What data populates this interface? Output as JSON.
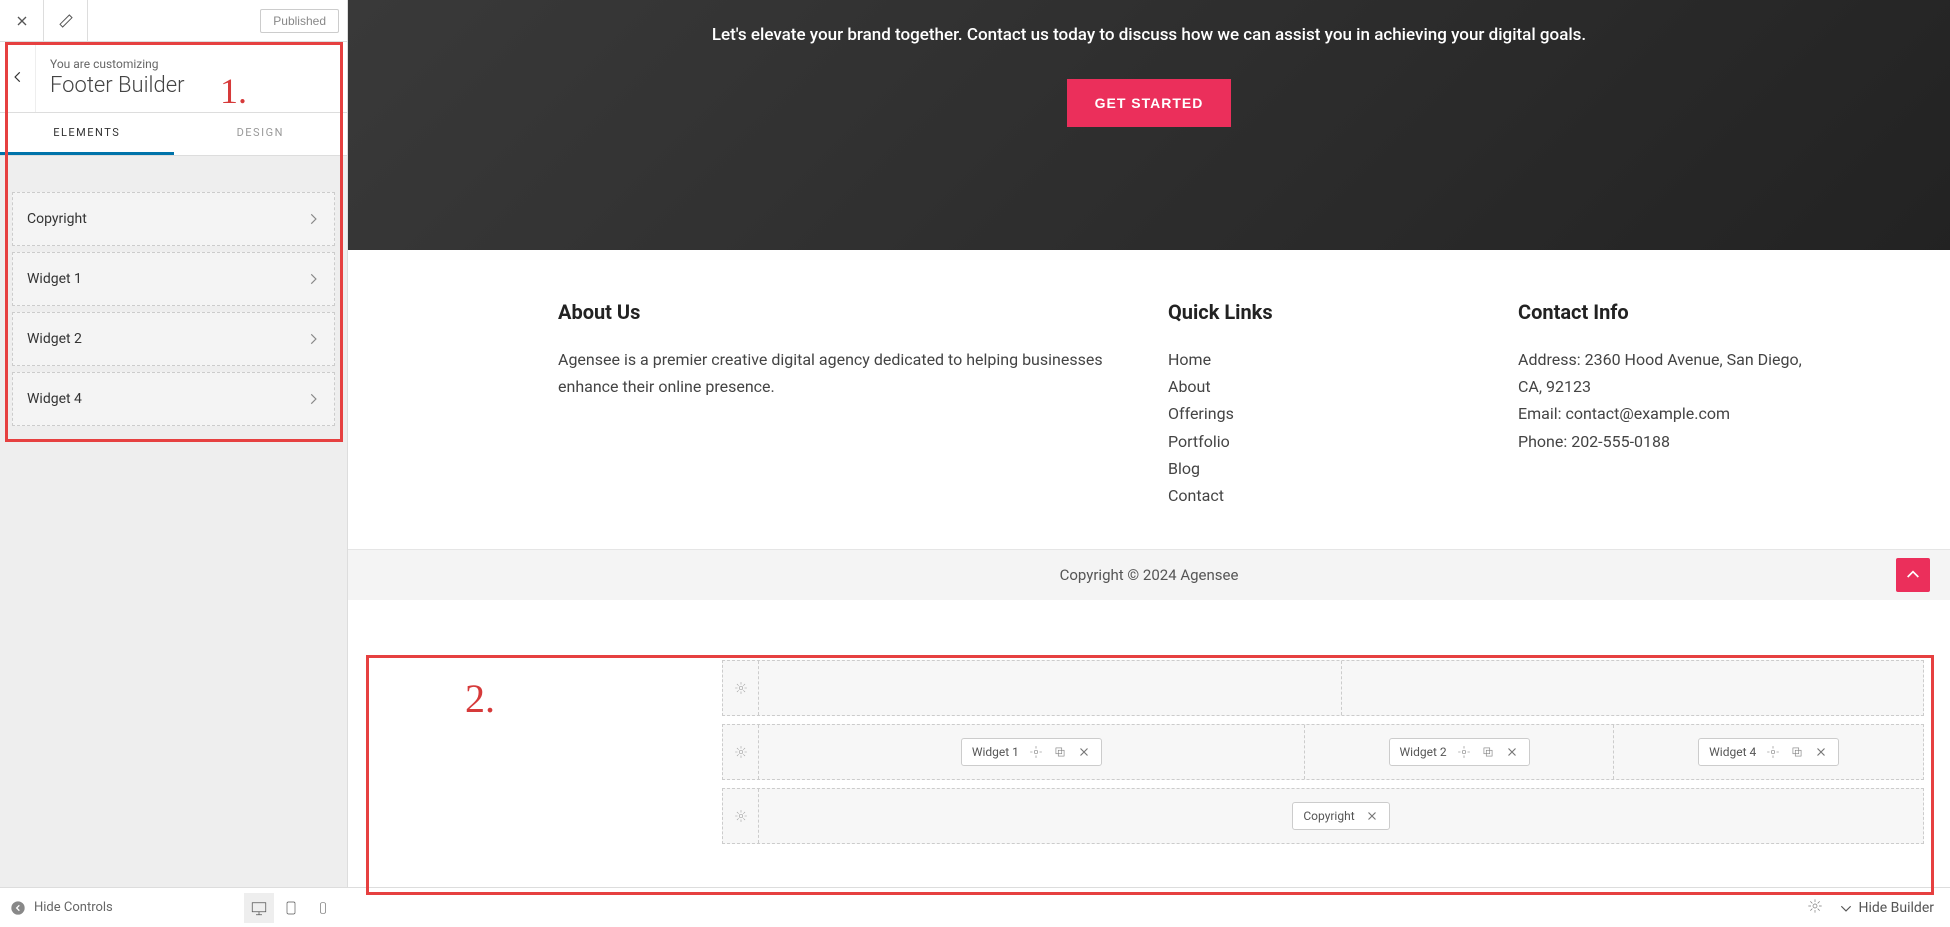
{
  "topbar": {
    "publish_label": "Published"
  },
  "customizer": {
    "breadcrumb": "You are customizing",
    "title": "Footer Builder",
    "tabs": {
      "elements": "ELEMENTS",
      "design": "DESIGN"
    },
    "elements": [
      "Copyright",
      "Widget 1",
      "Widget 2",
      "Widget 4"
    ]
  },
  "annotations": {
    "one": "1.",
    "two": "2."
  },
  "hero": {
    "subheadline": "Let's elevate your brand together. Contact us today to discuss how we can assist you in achieving your digital goals.",
    "cta": "GET STARTED"
  },
  "footer": {
    "about": {
      "title": "About Us",
      "text": "Agensee is a premier creative digital agency dedicated to helping businesses enhance their online presence."
    },
    "quicklinks": {
      "title": "Quick Links",
      "items": [
        "Home",
        "About",
        "Offerings",
        "Portfolio",
        "Blog",
        "Contact"
      ]
    },
    "contact": {
      "title": "Contact Info",
      "address": "Address: 2360 Hood Avenue, San Diego, CA, 92123",
      "email": "Email: contact@example.com",
      "phone": "Phone: 202-555-0188"
    },
    "copyright": "Copyright © 2024 Agensee"
  },
  "builder": {
    "row2": {
      "w1": "Widget 1",
      "w2": "Widget 2",
      "w4": "Widget 4"
    },
    "row3": {
      "copyright": "Copyright"
    }
  },
  "bottom": {
    "hide_controls": "Hide Controls",
    "hide_builder": "Hide Builder"
  }
}
